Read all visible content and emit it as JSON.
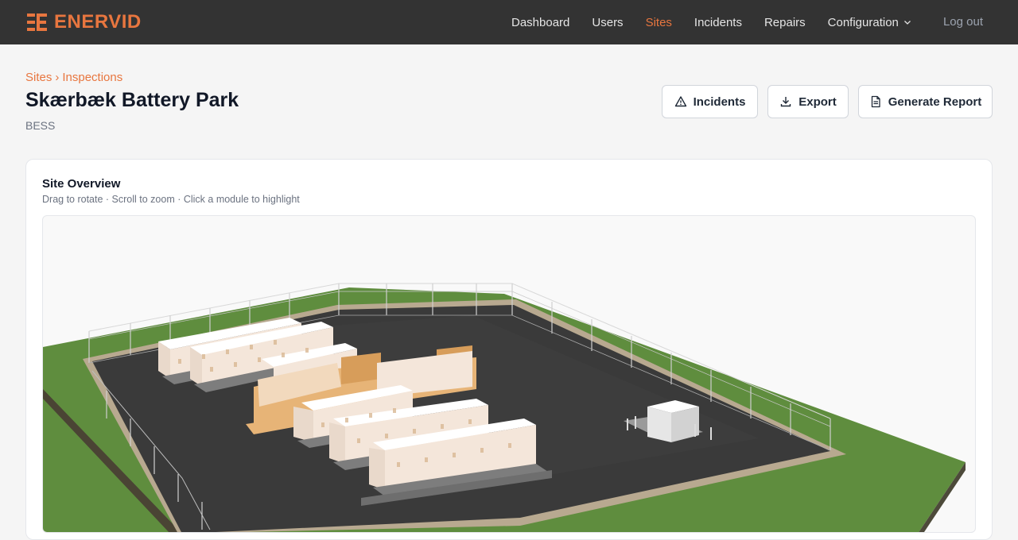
{
  "app": {
    "brand": "ENERVID"
  },
  "nav": {
    "items": [
      {
        "label": "Dashboard"
      },
      {
        "label": "Users"
      },
      {
        "label": "Sites"
      },
      {
        "label": "Incidents"
      },
      {
        "label": "Repairs"
      },
      {
        "label": "Configuration"
      }
    ],
    "active": "Sites",
    "logout_label": "Log out"
  },
  "breadcrumb": {
    "parent": "Sites",
    "separator": "›",
    "current": "Inspections"
  },
  "page": {
    "title": "Skærbæk Battery Park",
    "subtitle": "BESS"
  },
  "actions": {
    "incidents_label": "Incidents",
    "export_label": "Export",
    "report_label": "Generate Report"
  },
  "overview": {
    "title": "Site Overview",
    "hint": "Drag to rotate · Scroll to zoom · Click a module to highlight"
  },
  "colors": {
    "accent": "#e8763f",
    "topbar": "#333333",
    "grass": "#5f8d3e",
    "asphalt": "#3a3a3a",
    "module": "#f4e6da",
    "module_highlight": "#e7b477"
  },
  "icons": {
    "incidents": "warning-triangle-icon",
    "export": "download-icon",
    "report": "document-icon",
    "configuration": "chevron-down-icon"
  }
}
